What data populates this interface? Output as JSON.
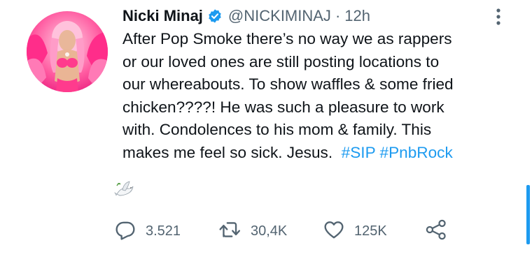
{
  "tweet": {
    "display_name": "Nicki Minaj",
    "handle": "@NICKIMINAJ",
    "separator": "·",
    "time": "12h",
    "verified_icon": "verified-badge-icon",
    "more_icon": "more-vertical-icon",
    "text_lines": [
      "After Pop Smoke there’s no way we as rappers",
      "or our loved ones are still posting locations to",
      "our whereabouts. To show waffles & some fried",
      "chicken????! He was such a pleasure to work",
      "with. Condolences to his mom & family. This",
      "makes me feel so sick. Jesus."
    ],
    "hashtags": [
      "#SIP",
      "#PnbRock"
    ],
    "emoji": "dove-emoji"
  },
  "actions": {
    "reply": {
      "icon": "reply-icon",
      "count": "3.521"
    },
    "retweet": {
      "icon": "retweet-icon",
      "count": "30,4K"
    },
    "like": {
      "icon": "heart-icon",
      "count": "125K"
    },
    "share": {
      "icon": "share-icon"
    }
  },
  "colors": {
    "accent": "#1d9bf0",
    "text": "#0f1419",
    "secondary": "#536471",
    "background": "#ffffff"
  }
}
